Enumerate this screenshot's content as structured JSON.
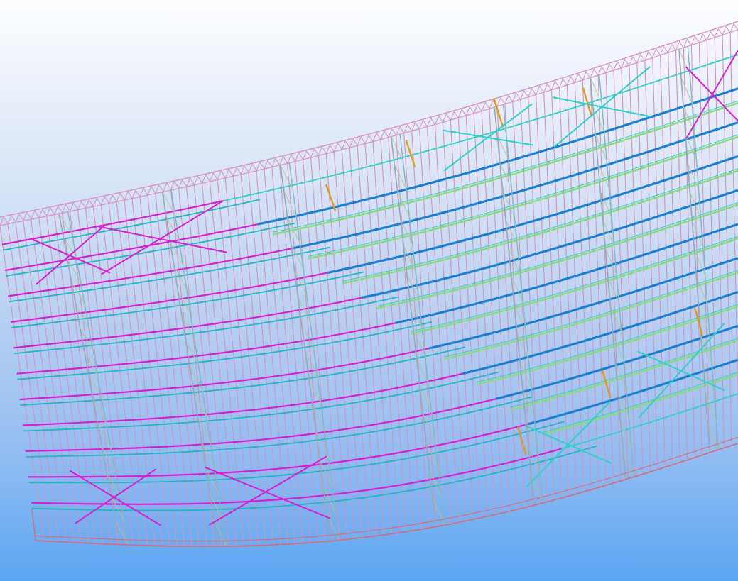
{
  "viewport": {
    "background_top": "#fdfeff",
    "background_bottom": "#5aa6f2"
  },
  "model": {
    "kind": "3D steel roof truss wireframe",
    "member_colors": {
      "purlins": "#d88fc0",
      "chords_magenta": "#d51fd4",
      "chords_cyan": "#1fb5c5",
      "primary_beams_blue": "#1b7fd0",
      "secondary_beams_green": "#8fd880",
      "bracing_teal": "#2fd0c8",
      "posts_orange": "#e09a20",
      "edge_red": "#d86a7a"
    }
  }
}
